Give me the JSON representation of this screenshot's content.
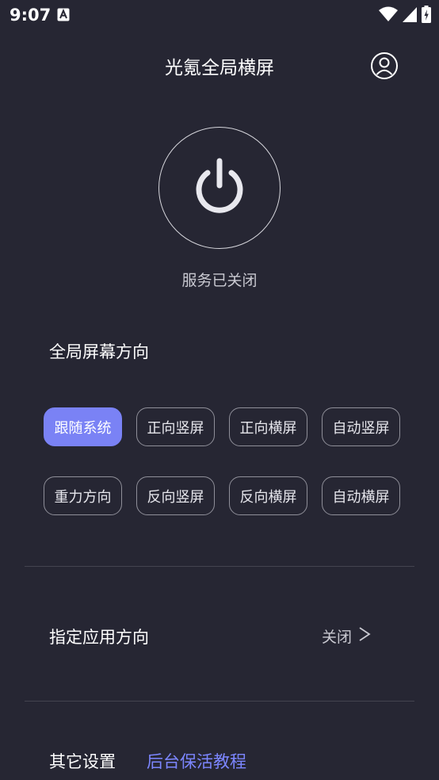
{
  "status_bar": {
    "time": "9:07",
    "icons": [
      "a-notification-icon",
      "wifi-icon",
      "cell-signal-icon",
      "battery-charging-icon"
    ]
  },
  "header": {
    "title": "光氪全局横屏",
    "account_icon": "account-icon"
  },
  "power": {
    "icon": "power-icon",
    "status": "服务已关闭"
  },
  "orientation": {
    "title": "全局屏幕方向",
    "options": [
      {
        "label": "跟随系统",
        "selected": true
      },
      {
        "label": "正向竖屏",
        "selected": false
      },
      {
        "label": "正向横屏",
        "selected": false
      },
      {
        "label": "自动竖屏",
        "selected": false
      },
      {
        "label": "重力方向",
        "selected": false
      },
      {
        "label": "反向竖屏",
        "selected": false
      },
      {
        "label": "反向横屏",
        "selected": false
      },
      {
        "label": "自动横屏",
        "selected": false
      }
    ]
  },
  "app_orientation": {
    "title": "指定应用方向",
    "value": "关闭",
    "arrow": ">"
  },
  "other": {
    "title": "其它设置",
    "link": "后台保活教程"
  },
  "colors": {
    "background": "#262633",
    "accent": "#7a82f5",
    "link": "#7c86ff"
  }
}
